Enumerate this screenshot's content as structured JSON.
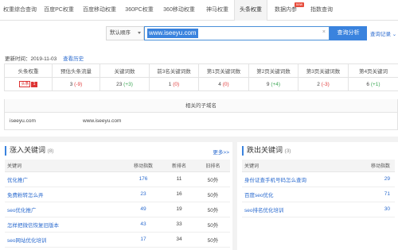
{
  "tabs": [
    {
      "label": "权重综合查询",
      "w": 50
    },
    {
      "label": "百度PC权重",
      "w": 48
    },
    {
      "label": "百度移动权重",
      "w": 54
    },
    {
      "label": "360PC权重",
      "w": 46
    },
    {
      "label": "360移动权重",
      "w": 54
    },
    {
      "label": "神马权重",
      "w": 42
    },
    {
      "label": "头条权重",
      "w": 42,
      "active": true
    },
    {
      "label": "数据内参",
      "w": 46,
      "badge": "new"
    },
    {
      "label": "指数查询",
      "w": 44
    }
  ],
  "search": {
    "order_select": "默认顺序",
    "query": "www.iseeyu.com",
    "clear": "×",
    "submit": "查询分析",
    "history": "查询记录 ⌄"
  },
  "updated": {
    "text": "更新时间：2019-11-03",
    "history_link": "查看历史"
  },
  "stats": {
    "headers": [
      "头条权重",
      "预估头条流量",
      "关键词数",
      "前3名关键词数",
      "第1页关键词数",
      "第2页关键词数",
      "第3页关键词数",
      "第4页关键词"
    ],
    "toutiao_logo": "头条",
    "toutiao_weight": "1",
    "flow": "3",
    "flow_delta": "(-9)",
    "kw_total": "23",
    "kw_total_delta": "(+3)",
    "top3": "1",
    "top3_delta": "(0)",
    "page1": "4",
    "page1_delta": "(0)",
    "page2": "9",
    "page2_delta": "(+4)",
    "page3": "2",
    "page3_delta": "(-3)",
    "page4": "6",
    "page4_delta": "(+1)"
  },
  "subdomains": {
    "title": "相关的子域名",
    "items": [
      "iseeyu.com",
      "www.iseeyu.com"
    ]
  },
  "rising": {
    "title": "涨入关键词",
    "count": "(8)",
    "more": "更多>>",
    "columns": [
      "关键词",
      "移动指数",
      "新排名",
      "旧排名"
    ],
    "rows": [
      {
        "kw": "优化推广",
        "idx": "176",
        "new": "11",
        "old": "50外"
      },
      {
        "kw": "免费粉转怎么弄",
        "idx": "23",
        "new": "16",
        "old": "50外"
      },
      {
        "kw": "seo优化推广",
        "idx": "49",
        "new": "19",
        "old": "50外"
      },
      {
        "kw": "怎样把微信恢复旧版本",
        "idx": "43",
        "new": "33",
        "old": "50外"
      },
      {
        "kw": "seo网站优化培训",
        "idx": "17",
        "new": "34",
        "old": "50外"
      }
    ]
  },
  "falling": {
    "title": "跌出关键词",
    "count": "(3)",
    "columns": [
      "关键词",
      "移动指数"
    ],
    "rows": [
      {
        "kw": "身份证查手机号码怎么查询",
        "idx": "29"
      },
      {
        "kw": "百度seo优化",
        "idx": "71"
      },
      {
        "kw": "seo排名优化培训",
        "idx": "30"
      }
    ]
  },
  "colors": {
    "accent": "#3a83de",
    "down": "#e03b3b",
    "up": "#3aa653",
    "link": "#2b6bcf"
  }
}
